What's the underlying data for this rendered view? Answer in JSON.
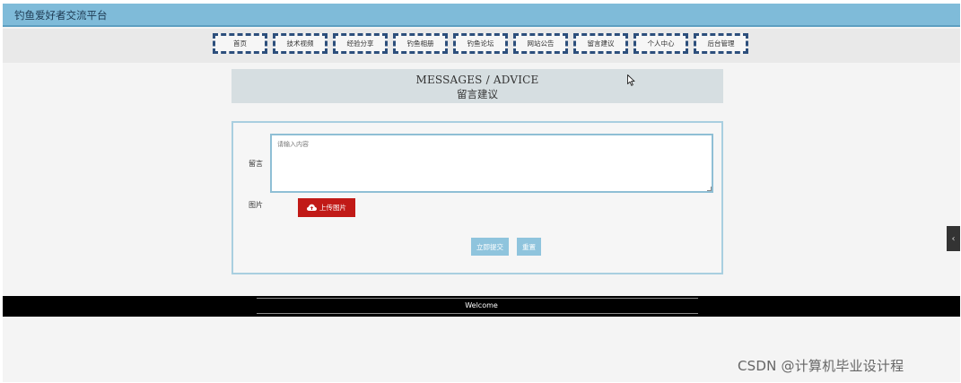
{
  "site": {
    "title": "钓鱼爱好者交流平台"
  },
  "nav": [
    {
      "label": "首页"
    },
    {
      "label": "技术视频"
    },
    {
      "label": "经验分享"
    },
    {
      "label": "钓鱼相册"
    },
    {
      "label": "钓鱼论坛"
    },
    {
      "label": "网站公告"
    },
    {
      "label": "留言建议"
    },
    {
      "label": "个人中心"
    },
    {
      "label": "后台管理"
    }
  ],
  "page_header": {
    "en": "MESSAGES / ADVICE",
    "cn": "留言建议"
  },
  "form": {
    "message_label": "留言",
    "message_placeholder": "请输入内容",
    "image_label": "图片",
    "upload_label": "上传图片",
    "upload_icon": "cloud-upload-icon",
    "submit_label": "立即提交",
    "reset_label": "重置"
  },
  "footer": {
    "welcome": "Welcome"
  },
  "side_tab": {
    "label": "‹",
    "icon": "chevron-left-icon"
  },
  "watermark": "CSDN @计算机毕业设计程",
  "colors": {
    "topbar": "#7fbbd9",
    "nav_border": "#2d4f7c",
    "upload_button": "#c11a17",
    "action_button": "#8fc4dd",
    "footer": "#000000"
  }
}
